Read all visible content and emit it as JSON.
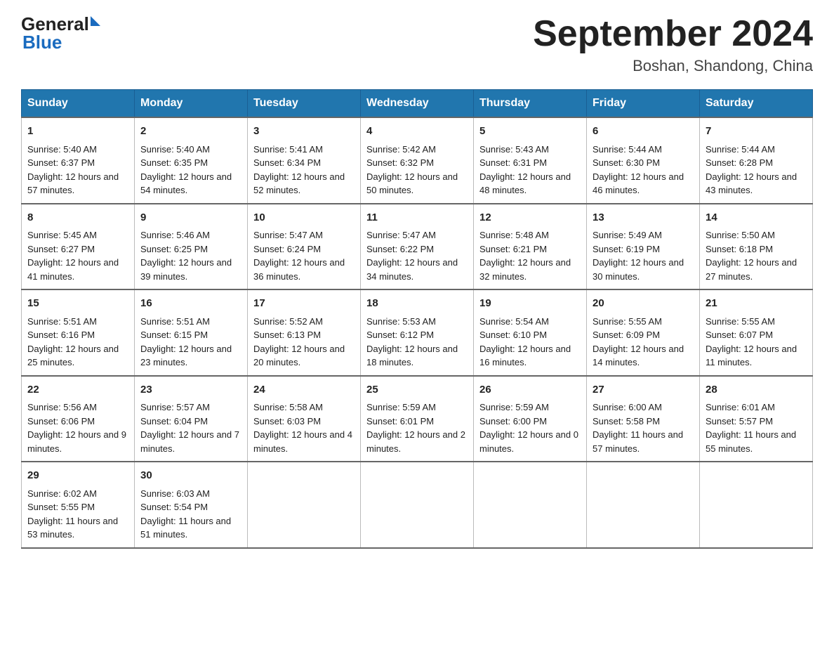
{
  "logo": {
    "text_general": "General",
    "triangle": "▶",
    "text_blue": "Blue"
  },
  "header": {
    "month_year": "September 2024",
    "location": "Boshan, Shandong, China"
  },
  "weekdays": [
    "Sunday",
    "Monday",
    "Tuesday",
    "Wednesday",
    "Thursday",
    "Friday",
    "Saturday"
  ],
  "weeks": [
    [
      {
        "day": "1",
        "sunrise": "Sunrise: 5:40 AM",
        "sunset": "Sunset: 6:37 PM",
        "daylight": "Daylight: 12 hours and 57 minutes."
      },
      {
        "day": "2",
        "sunrise": "Sunrise: 5:40 AM",
        "sunset": "Sunset: 6:35 PM",
        "daylight": "Daylight: 12 hours and 54 minutes."
      },
      {
        "day": "3",
        "sunrise": "Sunrise: 5:41 AM",
        "sunset": "Sunset: 6:34 PM",
        "daylight": "Daylight: 12 hours and 52 minutes."
      },
      {
        "day": "4",
        "sunrise": "Sunrise: 5:42 AM",
        "sunset": "Sunset: 6:32 PM",
        "daylight": "Daylight: 12 hours and 50 minutes."
      },
      {
        "day": "5",
        "sunrise": "Sunrise: 5:43 AM",
        "sunset": "Sunset: 6:31 PM",
        "daylight": "Daylight: 12 hours and 48 minutes."
      },
      {
        "day": "6",
        "sunrise": "Sunrise: 5:44 AM",
        "sunset": "Sunset: 6:30 PM",
        "daylight": "Daylight: 12 hours and 46 minutes."
      },
      {
        "day": "7",
        "sunrise": "Sunrise: 5:44 AM",
        "sunset": "Sunset: 6:28 PM",
        "daylight": "Daylight: 12 hours and 43 minutes."
      }
    ],
    [
      {
        "day": "8",
        "sunrise": "Sunrise: 5:45 AM",
        "sunset": "Sunset: 6:27 PM",
        "daylight": "Daylight: 12 hours and 41 minutes."
      },
      {
        "day": "9",
        "sunrise": "Sunrise: 5:46 AM",
        "sunset": "Sunset: 6:25 PM",
        "daylight": "Daylight: 12 hours and 39 minutes."
      },
      {
        "day": "10",
        "sunrise": "Sunrise: 5:47 AM",
        "sunset": "Sunset: 6:24 PM",
        "daylight": "Daylight: 12 hours and 36 minutes."
      },
      {
        "day": "11",
        "sunrise": "Sunrise: 5:47 AM",
        "sunset": "Sunset: 6:22 PM",
        "daylight": "Daylight: 12 hours and 34 minutes."
      },
      {
        "day": "12",
        "sunrise": "Sunrise: 5:48 AM",
        "sunset": "Sunset: 6:21 PM",
        "daylight": "Daylight: 12 hours and 32 minutes."
      },
      {
        "day": "13",
        "sunrise": "Sunrise: 5:49 AM",
        "sunset": "Sunset: 6:19 PM",
        "daylight": "Daylight: 12 hours and 30 minutes."
      },
      {
        "day": "14",
        "sunrise": "Sunrise: 5:50 AM",
        "sunset": "Sunset: 6:18 PM",
        "daylight": "Daylight: 12 hours and 27 minutes."
      }
    ],
    [
      {
        "day": "15",
        "sunrise": "Sunrise: 5:51 AM",
        "sunset": "Sunset: 6:16 PM",
        "daylight": "Daylight: 12 hours and 25 minutes."
      },
      {
        "day": "16",
        "sunrise": "Sunrise: 5:51 AM",
        "sunset": "Sunset: 6:15 PM",
        "daylight": "Daylight: 12 hours and 23 minutes."
      },
      {
        "day": "17",
        "sunrise": "Sunrise: 5:52 AM",
        "sunset": "Sunset: 6:13 PM",
        "daylight": "Daylight: 12 hours and 20 minutes."
      },
      {
        "day": "18",
        "sunrise": "Sunrise: 5:53 AM",
        "sunset": "Sunset: 6:12 PM",
        "daylight": "Daylight: 12 hours and 18 minutes."
      },
      {
        "day": "19",
        "sunrise": "Sunrise: 5:54 AM",
        "sunset": "Sunset: 6:10 PM",
        "daylight": "Daylight: 12 hours and 16 minutes."
      },
      {
        "day": "20",
        "sunrise": "Sunrise: 5:55 AM",
        "sunset": "Sunset: 6:09 PM",
        "daylight": "Daylight: 12 hours and 14 minutes."
      },
      {
        "day": "21",
        "sunrise": "Sunrise: 5:55 AM",
        "sunset": "Sunset: 6:07 PM",
        "daylight": "Daylight: 12 hours and 11 minutes."
      }
    ],
    [
      {
        "day": "22",
        "sunrise": "Sunrise: 5:56 AM",
        "sunset": "Sunset: 6:06 PM",
        "daylight": "Daylight: 12 hours and 9 minutes."
      },
      {
        "day": "23",
        "sunrise": "Sunrise: 5:57 AM",
        "sunset": "Sunset: 6:04 PM",
        "daylight": "Daylight: 12 hours and 7 minutes."
      },
      {
        "day": "24",
        "sunrise": "Sunrise: 5:58 AM",
        "sunset": "Sunset: 6:03 PM",
        "daylight": "Daylight: 12 hours and 4 minutes."
      },
      {
        "day": "25",
        "sunrise": "Sunrise: 5:59 AM",
        "sunset": "Sunset: 6:01 PM",
        "daylight": "Daylight: 12 hours and 2 minutes."
      },
      {
        "day": "26",
        "sunrise": "Sunrise: 5:59 AM",
        "sunset": "Sunset: 6:00 PM",
        "daylight": "Daylight: 12 hours and 0 minutes."
      },
      {
        "day": "27",
        "sunrise": "Sunrise: 6:00 AM",
        "sunset": "Sunset: 5:58 PM",
        "daylight": "Daylight: 11 hours and 57 minutes."
      },
      {
        "day": "28",
        "sunrise": "Sunrise: 6:01 AM",
        "sunset": "Sunset: 5:57 PM",
        "daylight": "Daylight: 11 hours and 55 minutes."
      }
    ],
    [
      {
        "day": "29",
        "sunrise": "Sunrise: 6:02 AM",
        "sunset": "Sunset: 5:55 PM",
        "daylight": "Daylight: 11 hours and 53 minutes."
      },
      {
        "day": "30",
        "sunrise": "Sunrise: 6:03 AM",
        "sunset": "Sunset: 5:54 PM",
        "daylight": "Daylight: 11 hours and 51 minutes."
      },
      null,
      null,
      null,
      null,
      null
    ]
  ]
}
